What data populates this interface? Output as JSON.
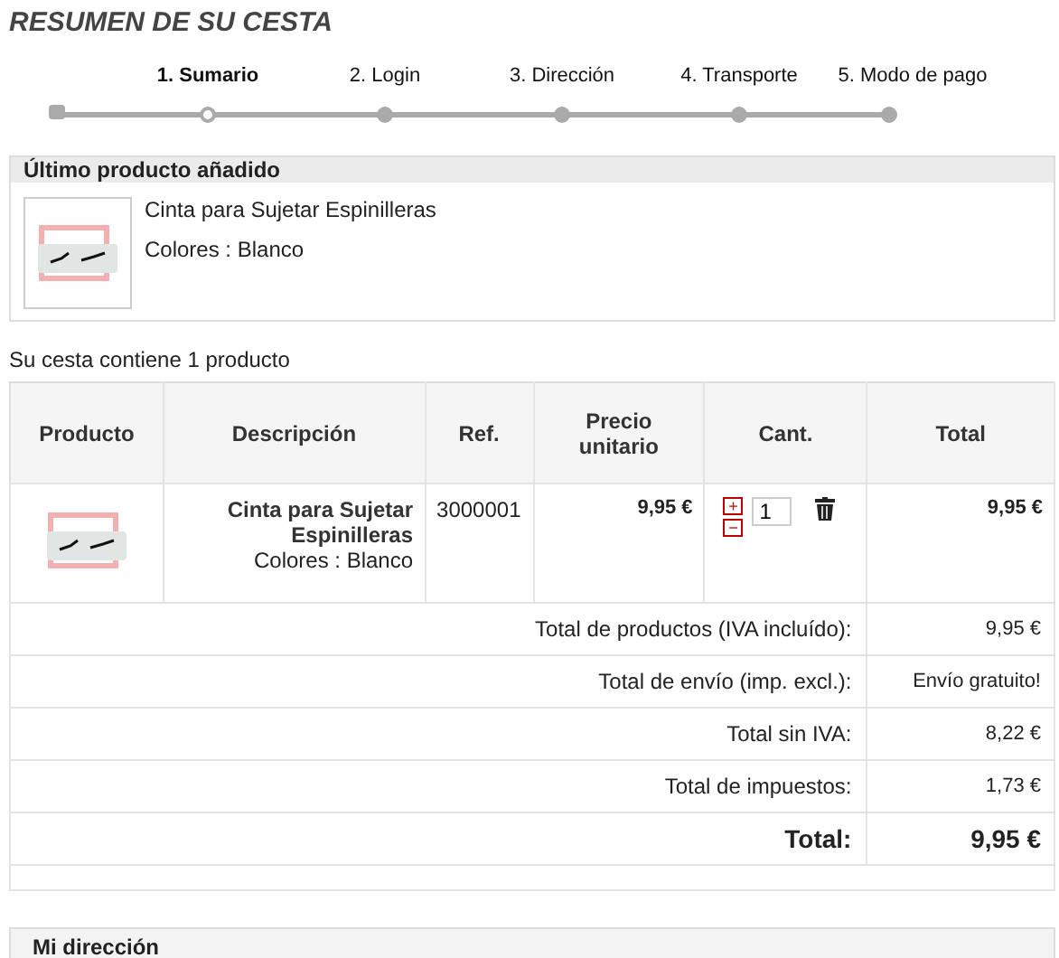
{
  "title": "RESUMEN DE SU CESTA",
  "steps": [
    {
      "label": "1. Sumario",
      "selected": true
    },
    {
      "label": "2. Login",
      "selected": false
    },
    {
      "label": "3. Dirección",
      "selected": false
    },
    {
      "label": "4. Transporte",
      "selected": false
    },
    {
      "label": "5. Modo de pago",
      "selected": false
    }
  ],
  "last_added": {
    "heading": "Último producto añadido",
    "name": "Cinta para Sujetar Espinilleras",
    "attributes": "Colores : Blanco"
  },
  "summary_text": "Su cesta contiene 1 producto",
  "table": {
    "columns": [
      "Producto",
      "Descripción",
      "Ref.",
      "Precio unitario",
      "Cant.",
      "Total"
    ],
    "rows": [
      {
        "name": "Cinta para Sujetar Espinilleras",
        "attributes": "Colores : Blanco",
        "ref": "3000001",
        "unit_price": "9,95 €",
        "quantity": "1",
        "increase": "+",
        "decrease": "−",
        "total": "9,95 €"
      }
    ],
    "totals": [
      {
        "label": "Total de productos (IVA incluído):",
        "value": "9,95 €",
        "emphasis": false
      },
      {
        "label": "Total de envío (imp. excl.):",
        "value": "Envío gratuito!",
        "emphasis": false
      },
      {
        "label": "Total sin IVA:",
        "value": "8,22 €",
        "emphasis": false
      },
      {
        "label": "Total de impuestos:",
        "value": "1,73 €",
        "emphasis": false
      },
      {
        "label": "Total:",
        "value": "9,95 €",
        "emphasis": true
      }
    ]
  },
  "next_panel": {
    "heading": "Mi dirección"
  }
}
